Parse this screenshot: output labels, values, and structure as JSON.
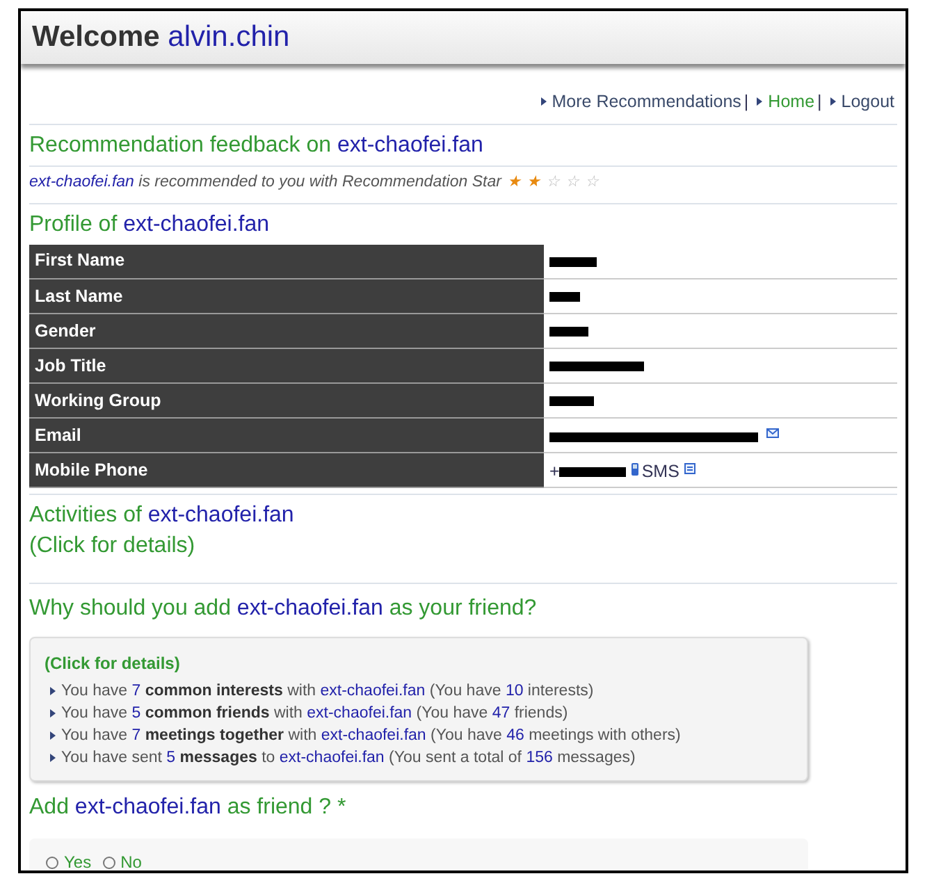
{
  "header": {
    "title": "Welcome",
    "user": "alvin.chin"
  },
  "nav_links": [
    "More Recommendations",
    "Home",
    "Logout"
  ],
  "nav_separator": "|",
  "feedback": {
    "heading": [
      {
        "kind": "plain",
        "text": "Recommendation feedback on "
      },
      {
        "kind": "name",
        "text": "ext-chaofei.fan"
      }
    ],
    "sentence": [
      {
        "kind": "name",
        "text": "ext-chaofei.fan"
      },
      {
        "kind": "plain",
        "text": " is recommended to you with Recommendation Star"
      }
    ],
    "stars": 2
  },
  "profile": {
    "heading": [
      {
        "kind": "plain",
        "text": "Profile of "
      },
      {
        "kind": "name",
        "text": "ext-chaofei.fan"
      }
    ],
    "rows": [
      {
        "label": "First Name",
        "kind": "redacted"
      },
      {
        "label": "Last Name",
        "kind": "redacted"
      },
      {
        "label": "Gender",
        "kind": "redacted"
      },
      {
        "label": "Job Title",
        "kind": "redacted"
      },
      {
        "label": "Working Group",
        "kind": "redacted"
      },
      {
        "label": "Email",
        "kind": "email"
      },
      {
        "label": "Mobile Phone",
        "kind": "phone",
        "prefix": "+",
        "sms": "SMS"
      }
    ]
  },
  "activities": {
    "heading": [
      {
        "kind": "plain",
        "text": "Activities of "
      },
      {
        "kind": "name",
        "text": "ext-chaofei.fan"
      }
    ],
    "details": "(Click for details)"
  },
  "why": {
    "heading": [
      {
        "kind": "plain",
        "text": "Why should you add "
      },
      {
        "kind": "name",
        "text": "ext-chaofei.fan"
      },
      {
        "kind": "plain",
        "text": " as your friend?"
      }
    ],
    "details": "(Click for details)",
    "reasons": [
      [
        {
          "kind": "plain",
          "text": "You have "
        },
        {
          "kind": "number",
          "text": "7"
        },
        {
          "kind": "bold",
          "text": " common interests"
        },
        {
          "kind": "plain",
          "text": " with "
        },
        {
          "kind": "name",
          "text": "ext-chaofei.fan"
        },
        {
          "kind": "plain",
          "text": " (You have "
        },
        {
          "kind": "number",
          "text": "10"
        },
        {
          "kind": "plain",
          "text": " interests)"
        }
      ],
      [
        {
          "kind": "plain",
          "text": "You have "
        },
        {
          "kind": "number",
          "text": "5"
        },
        {
          "kind": "bold",
          "text": " common friends"
        },
        {
          "kind": "plain",
          "text": " with "
        },
        {
          "kind": "name",
          "text": "ext-chaofei.fan"
        },
        {
          "kind": "plain",
          "text": " (You have "
        },
        {
          "kind": "number",
          "text": "47"
        },
        {
          "kind": "plain",
          "text": " friends)"
        }
      ],
      [
        {
          "kind": "plain",
          "text": "You have "
        },
        {
          "kind": "number",
          "text": "7"
        },
        {
          "kind": "bold",
          "text": " meetings together"
        },
        {
          "kind": "plain",
          "text": " with "
        },
        {
          "kind": "name",
          "text": "ext-chaofei.fan"
        },
        {
          "kind": "plain",
          "text": " (You have "
        },
        {
          "kind": "number",
          "text": "46"
        },
        {
          "kind": "plain",
          "text": " meetings with others)"
        }
      ],
      [
        {
          "kind": "plain",
          "text": "You have sent "
        },
        {
          "kind": "number",
          "text": "5"
        },
        {
          "kind": "bold",
          "text": " messages"
        },
        {
          "kind": "plain",
          "text": " to "
        },
        {
          "kind": "name",
          "text": "ext-chaofei.fan"
        },
        {
          "kind": "plain",
          "text": " (You sent a total of "
        },
        {
          "kind": "number",
          "text": "156"
        },
        {
          "kind": "plain",
          "text": " messages)"
        }
      ]
    ]
  },
  "add_friend": {
    "heading": [
      {
        "kind": "plain",
        "text": "Add "
      },
      {
        "kind": "name",
        "text": "ext-chaofei.fan"
      },
      {
        "kind": "plain",
        "text": " as friend ? *"
      }
    ],
    "options": [
      {
        "label": "Yes",
        "selected": false
      },
      {
        "label": "No",
        "selected": false
      }
    ]
  }
}
